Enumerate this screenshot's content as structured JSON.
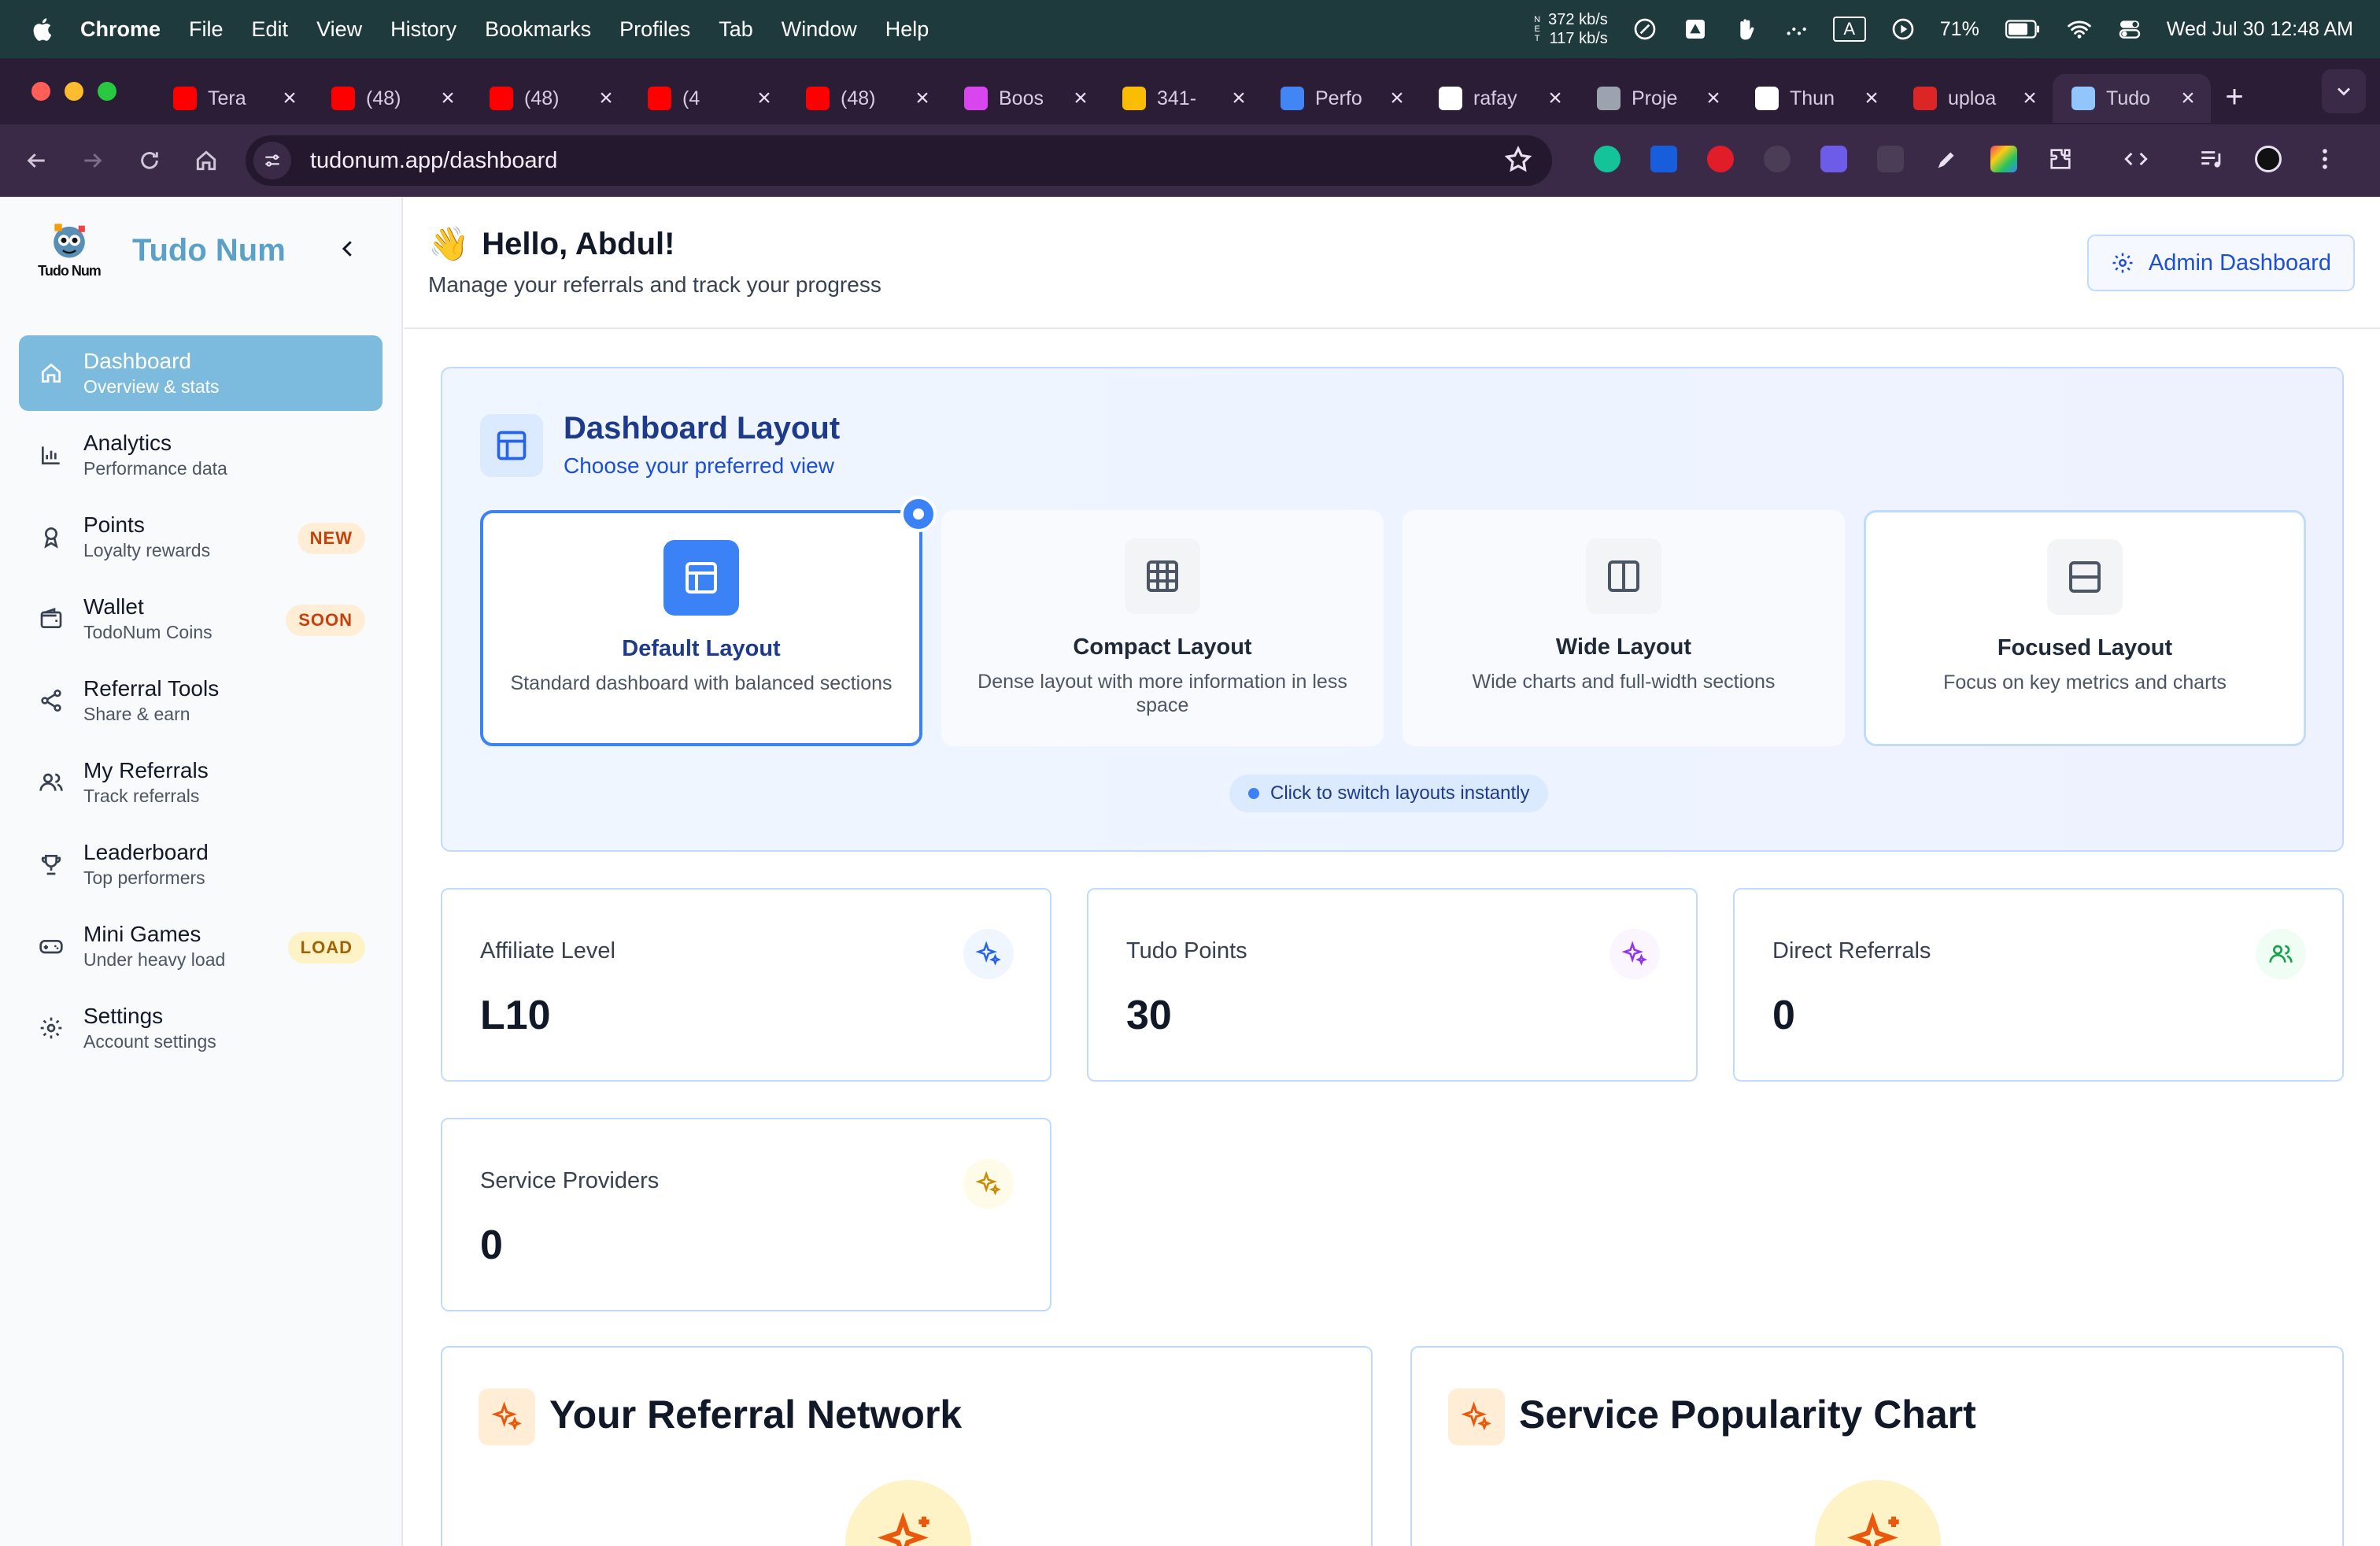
{
  "menubar": {
    "app": "Chrome",
    "items": [
      "File",
      "Edit",
      "View",
      "History",
      "Bookmarks",
      "Profiles",
      "Tab",
      "Window",
      "Help"
    ],
    "net_label": "N E T",
    "net_up": "372 kb/s",
    "net_down": "117 kb/s",
    "input_source": "A",
    "battery": "71%",
    "datetime": "Wed Jul 30  12:48 AM"
  },
  "tabs": [
    {
      "label": "Tera",
      "icon": "youtube-icon",
      "color": "#ff0000"
    },
    {
      "label": "(48)",
      "icon": "youtube-icon",
      "color": "#ff0000"
    },
    {
      "label": "(48)",
      "icon": "youtube-icon",
      "color": "#ff0000"
    },
    {
      "label": "(4",
      "icon": "youtube-icon",
      "color": "#ff0000"
    },
    {
      "label": "(48)",
      "icon": "youtube-icon",
      "color": "#ff0000"
    },
    {
      "label": "Boos",
      "icon": "chat-icon",
      "color": "#d946ef"
    },
    {
      "label": "341-",
      "icon": "google-ads-icon",
      "color": "#fbbc04"
    },
    {
      "label": "Perfo",
      "icon": "analytics-icon",
      "color": "#4285f4"
    },
    {
      "label": "rafay",
      "icon": "github-icon",
      "color": "#ffffff"
    },
    {
      "label": "Proje",
      "icon": "project-icon",
      "color": "#9ca3af"
    },
    {
      "label": "Thun",
      "icon": "openai-icon",
      "color": "#ffffff"
    },
    {
      "label": "uploa",
      "icon": "puzzle-icon",
      "color": "#dc2626"
    },
    {
      "label": "Tudo",
      "icon": "tudonum-icon",
      "color": "#93c5fd"
    }
  ],
  "omnibox": {
    "url": "tudonum.app/dashboard"
  },
  "brand": {
    "name": "Tudo Num",
    "logo_text": "Tudo Num"
  },
  "nav": [
    {
      "label": "Dashboard",
      "sub": "Overview & stats",
      "icon": "home-icon",
      "badge": ""
    },
    {
      "label": "Analytics",
      "sub": "Performance data",
      "icon": "bar-chart-icon",
      "badge": ""
    },
    {
      "label": "Points",
      "sub": "Loyalty rewards",
      "icon": "award-icon",
      "badge": "NEW"
    },
    {
      "label": "Wallet",
      "sub": "TodoNum Coins",
      "icon": "wallet-icon",
      "badge": "SOON"
    },
    {
      "label": "Referral Tools",
      "sub": "Share & earn",
      "icon": "share-icon",
      "badge": ""
    },
    {
      "label": "My Referrals",
      "sub": "Track referrals",
      "icon": "users-icon",
      "badge": ""
    },
    {
      "label": "Leaderboard",
      "sub": "Top performers",
      "icon": "trophy-icon",
      "badge": ""
    },
    {
      "label": "Mini Games",
      "sub": "Under heavy load",
      "icon": "gamepad-icon",
      "badge": "LOAD"
    },
    {
      "label": "Settings",
      "sub": "Account settings",
      "icon": "gear-icon",
      "badge": ""
    }
  ],
  "header": {
    "wave": "👋",
    "greeting": "Hello, Abdul!",
    "subtitle": "Manage your referrals and track your progress",
    "admin_button": "Admin Dashboard"
  },
  "layout_panel": {
    "title": "Dashboard Layout",
    "subtitle": "Choose your preferred view",
    "hint": "Click to switch layouts instantly",
    "options": [
      {
        "title": "Default Layout",
        "desc": "Standard dashboard with balanced sections",
        "selected": true
      },
      {
        "title": "Compact Layout",
        "desc": "Dense layout with more information in less space",
        "selected": false
      },
      {
        "title": "Wide Layout",
        "desc": "Wide charts and full-width sections",
        "selected": false
      },
      {
        "title": "Focused Layout",
        "desc": "Focus on key metrics and charts",
        "selected": false
      }
    ]
  },
  "stats": [
    {
      "label": "Affiliate Level",
      "value": "L10",
      "icon": "sparkles-icon",
      "accent": "#2563eb",
      "bg": "#eff6ff"
    },
    {
      "label": "Tudo Points",
      "value": "30",
      "icon": "sparkles-icon",
      "accent": "#9333ea",
      "bg": "#faf5ff"
    },
    {
      "label": "Direct Referrals",
      "value": "0",
      "icon": "users-icon",
      "accent": "#16a34a",
      "bg": "#f0fdf4"
    },
    {
      "label": "Service Providers",
      "value": "0",
      "icon": "sparkles-icon",
      "accent": "#ca8a04",
      "bg": "#fefce8"
    }
  ],
  "sections": [
    {
      "title": "Your Referral Network",
      "icon": "sparkles-icon"
    },
    {
      "title": "Service Popularity Chart",
      "icon": "sparkles-icon"
    }
  ],
  "colors": {
    "sidebar_active": "#7cbbdd",
    "primary": "#3b82f6",
    "brand": "#5aa0c8",
    "menubar_bg": "#1f3a3d",
    "chrome_bg": "#3a2a47"
  }
}
